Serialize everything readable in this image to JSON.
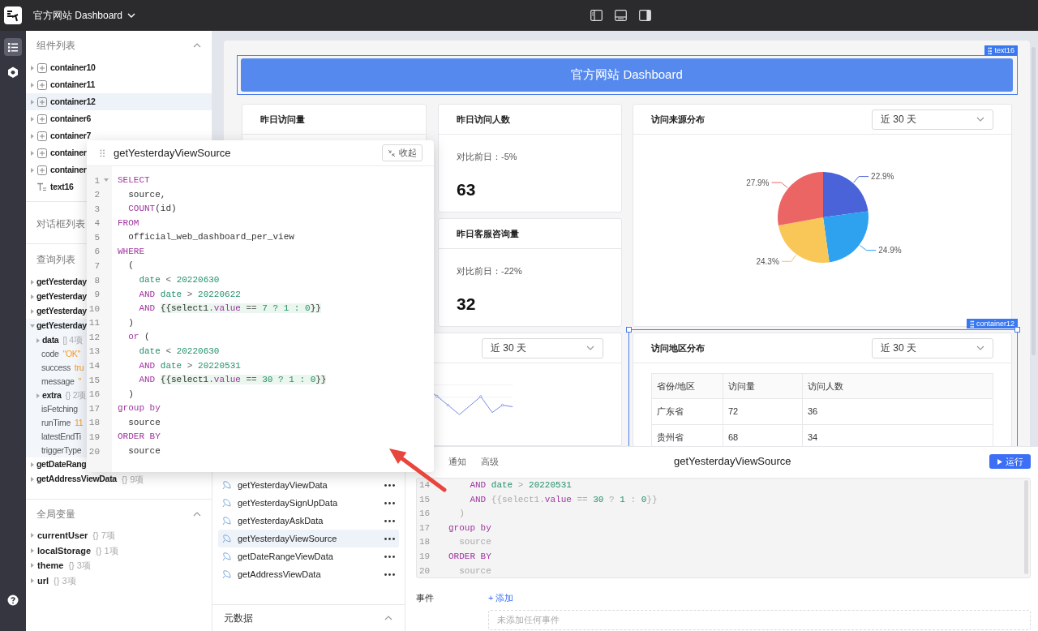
{
  "app": {
    "title": "官方网站 Dashboard"
  },
  "rail": [
    {
      "kind": "tree",
      "selected": true
    },
    {
      "kind": "settings",
      "selected": false
    }
  ],
  "components": {
    "title": "组件列表",
    "expanded": true,
    "items": [
      {
        "label": "container10",
        "kind": "container",
        "expanded": false,
        "selected": false
      },
      {
        "label": "container11",
        "kind": "container",
        "expanded": false,
        "selected": false
      },
      {
        "label": "container12",
        "kind": "container",
        "expanded": false,
        "selected": true
      },
      {
        "label": "container6",
        "kind": "container",
        "expanded": false,
        "selected": false
      },
      {
        "label": "container7",
        "kind": "container",
        "expanded": false,
        "selected": false
      },
      {
        "label": "container",
        "kind": "container",
        "expanded": false,
        "selected": false
      },
      {
        "label": "container",
        "kind": "container",
        "expanded": false,
        "selected": false
      },
      {
        "label": "text16",
        "kind": "text",
        "selected": false
      }
    ]
  },
  "dialogs": {
    "title": "对话框列表"
  },
  "queries": {
    "title": "查询列表",
    "items": [
      {
        "label": "getYesterday",
        "expanded": false
      },
      {
        "label": "getYesterday",
        "expanded": false
      },
      {
        "label": "getYesterday",
        "expanded": false
      },
      {
        "label": "getYesterday",
        "expanded": true,
        "children": [
          {
            "key": "data",
            "kind": "object",
            "value": "[] 4项",
            "expanded": false
          },
          {
            "key": "code",
            "kind": "value",
            "value": "\"OK\""
          },
          {
            "key": "success",
            "kind": "value",
            "value": "tru"
          },
          {
            "key": "message",
            "kind": "value",
            "value": "\""
          },
          {
            "key": "extra",
            "kind": "object",
            "value": "{} 2项",
            "expanded": false
          },
          {
            "key": "isFetching",
            "kind": "value"
          },
          {
            "key": "runTime",
            "kind": "value",
            "value": "11"
          },
          {
            "key": "latestEndTi",
            "kind": "value"
          },
          {
            "key": "triggerType",
            "kind": "value"
          }
        ]
      },
      {
        "label": "getDateRang",
        "expanded": false
      },
      {
        "label": "getAddressViewData",
        "count": "{} 9项",
        "expanded": false
      }
    ]
  },
  "globals": {
    "title": "全局变量",
    "expanded": true,
    "items": [
      {
        "label": "currentUser",
        "count": "{} 7项",
        "expanded": false
      },
      {
        "label": "localStorage",
        "count": "{} 1项",
        "expanded": false
      },
      {
        "label": "theme",
        "count": "{} 3项",
        "expanded": false
      },
      {
        "label": "url",
        "count": "{} 3项",
        "expanded": false
      }
    ]
  },
  "canvas": {
    "banner": {
      "text": "官方网站 Dashboard",
      "tag": "text16"
    },
    "stat_cards": [
      {
        "title": "昨日访问量"
      },
      {
        "title": "昨日访问人数",
        "compare": "对比前日：-5%",
        "value": "63"
      },
      {
        "title": "昨日客服咨询量",
        "compare": "对比前日：-22%",
        "value": "32"
      }
    ],
    "source_card": {
      "title": "访问来源分布",
      "select": "近 30 天",
      "chart_data": {
        "type": "pie",
        "values": [
          22.9,
          24.9,
          24.3,
          27.9
        ],
        "value_labels": [
          "22.9%",
          "24.9%",
          "24.3%",
          "27.9%"
        ]
      }
    },
    "trend_card": {
      "select": "近 30 天"
    },
    "region_card": {
      "title": "访问地区分布",
      "select": "近 30 天",
      "tag": "container12",
      "table": {
        "columns": [
          "省份/地区",
          "访问量",
          "访问人数"
        ],
        "rows": [
          [
            "广东省",
            "72",
            "36"
          ],
          [
            "贵州省",
            "68",
            "34"
          ]
        ]
      }
    }
  },
  "popup": {
    "title": "getYesterdayViewSource",
    "button": "收起",
    "lines": [
      {
        "n": "1",
        "fold": true,
        "tokens": [
          {
            "kind": "keyword",
            "text": "SELECT"
          }
        ]
      },
      {
        "n": "2",
        "fold": false,
        "tokens": [
          {
            "kind": "plain",
            "text": "  source,"
          }
        ]
      },
      {
        "n": "3",
        "fold": false,
        "tokens": [
          {
            "kind": "keyword",
            "text": "  COUNT"
          },
          {
            "kind": "plain",
            "text": "(id)"
          }
        ]
      },
      {
        "n": "4",
        "fold": false,
        "tokens": [
          {
            "kind": "keyword",
            "text": "FROM"
          }
        ]
      },
      {
        "n": "5",
        "fold": false,
        "tokens": [
          {
            "kind": "plain",
            "text": "  official_web_dashboard_per_view"
          }
        ]
      },
      {
        "n": "6",
        "fold": false,
        "tokens": [
          {
            "kind": "keyword",
            "text": "WHERE"
          }
        ]
      },
      {
        "n": "7",
        "fold": false,
        "tokens": [
          {
            "kind": "plain",
            "text": "  ("
          }
        ]
      },
      {
        "n": "8",
        "fold": false,
        "tokens": [
          {
            "kind": "field",
            "text": "    date"
          },
          {
            "kind": "operator",
            "text": " < "
          },
          {
            "kind": "number",
            "text": "20220630"
          }
        ]
      },
      {
        "n": "9",
        "fold": false,
        "tokens": [
          {
            "kind": "keyword",
            "text": "    AND "
          },
          {
            "kind": "field",
            "text": "date"
          },
          {
            "kind": "operator",
            "text": " > "
          },
          {
            "kind": "number",
            "text": "20220622"
          }
        ]
      },
      {
        "n": "10",
        "fold": false,
        "tokens": [
          {
            "kind": "keyword",
            "text": "    AND "
          },
          {
            "kind": "template",
            "parts": [
              {
                "kind": "plain",
                "text": "{{select1"
              },
              {
                "kind": "keyword",
                "text": ".value"
              },
              {
                "kind": "operator",
                "text": " == "
              },
              {
                "kind": "number",
                "text": "7 ? 1 : 0"
              },
              {
                "kind": "plain",
                "text": "}}"
              }
            ]
          }
        ]
      },
      {
        "n": "11",
        "fold": false,
        "tokens": [
          {
            "kind": "plain",
            "text": "  )"
          }
        ]
      },
      {
        "n": "12",
        "fold": false,
        "tokens": [
          {
            "kind": "keyword",
            "text": "  or "
          },
          {
            "kind": "plain",
            "text": "("
          }
        ]
      },
      {
        "n": "13",
        "fold": false,
        "tokens": [
          {
            "kind": "field",
            "text": "    date"
          },
          {
            "kind": "operator",
            "text": " < "
          },
          {
            "kind": "number",
            "text": "20220630"
          }
        ]
      },
      {
        "n": "14",
        "fold": false,
        "tokens": [
          {
            "kind": "keyword",
            "text": "    AND "
          },
          {
            "kind": "field",
            "text": "date"
          },
          {
            "kind": "operator",
            "text": " > "
          },
          {
            "kind": "number",
            "text": "20220531"
          }
        ]
      },
      {
        "n": "15",
        "fold": false,
        "tokens": [
          {
            "kind": "keyword",
            "text": "    AND "
          },
          {
            "kind": "template",
            "parts": [
              {
                "kind": "plain",
                "text": "{{select1"
              },
              {
                "kind": "keyword",
                "text": ".value"
              },
              {
                "kind": "operator",
                "text": " == "
              },
              {
                "kind": "number",
                "text": "30 ? 1 : 0"
              },
              {
                "kind": "plain",
                "text": "}}"
              }
            ]
          }
        ]
      },
      {
        "n": "16",
        "fold": false,
        "tokens": [
          {
            "kind": "plain",
            "text": "  )"
          }
        ]
      },
      {
        "n": "17",
        "fold": false,
        "tokens": [
          {
            "kind": "keyword",
            "text": "group by"
          }
        ]
      },
      {
        "n": "18",
        "fold": false,
        "tokens": [
          {
            "kind": "plain",
            "text": "  source"
          }
        ]
      },
      {
        "n": "19",
        "fold": false,
        "tokens": [
          {
            "kind": "keyword",
            "text": "ORDER BY"
          }
        ]
      },
      {
        "n": "20",
        "fold": false,
        "tokens": [
          {
            "kind": "plain",
            "text": "  source"
          }
        ]
      }
    ]
  },
  "bottom": {
    "queries": [
      {
        "label": "getYesterdayViewData",
        "selected": false
      },
      {
        "label": "getYesterdaySignUpData",
        "selected": false
      },
      {
        "label": "getYesterdayAskData",
        "selected": false
      },
      {
        "label": "getYesterdayViewSource",
        "selected": true
      },
      {
        "label": "getDateRangeViewData",
        "selected": false
      },
      {
        "label": "getAddressViewData",
        "selected": false
      }
    ],
    "section": {
      "title": "元数据",
      "expanded": true
    },
    "tabs": [
      {
        "label": "通知",
        "selected": false
      },
      {
        "label": "高级",
        "selected": false
      }
    ],
    "title": "getYesterdayViewSource",
    "run": "运行",
    "lines": [
      {
        "n": "14",
        "tokens": [
          {
            "kind": "keyword",
            "text": "    AND "
          },
          {
            "kind": "field",
            "text": "date"
          },
          {
            "kind": "operator",
            "text": " > "
          },
          {
            "kind": "number",
            "text": "20220531"
          }
        ]
      },
      {
        "n": "15",
        "tokens": [
          {
            "kind": "keyword",
            "text": "    AND "
          },
          {
            "kind": "operator",
            "text": "{{select1."
          },
          {
            "kind": "keyword",
            "text": "value"
          },
          {
            "kind": "operator",
            "text": " == "
          },
          {
            "kind": "number",
            "text": "30"
          },
          {
            "kind": "operator",
            "text": " ? "
          },
          {
            "kind": "number",
            "text": "1"
          },
          {
            "kind": "operator",
            "text": " : "
          },
          {
            "kind": "number",
            "text": "0"
          },
          {
            "kind": "operator",
            "text": "}}"
          }
        ]
      },
      {
        "n": "16",
        "tokens": [
          {
            "kind": "operator",
            "text": "  )"
          }
        ]
      },
      {
        "n": "17",
        "tokens": [
          {
            "kind": "keyword",
            "text": "group by"
          }
        ]
      },
      {
        "n": "18",
        "tokens": [
          {
            "kind": "operator",
            "text": "  source"
          }
        ]
      },
      {
        "n": "19",
        "tokens": [
          {
            "kind": "keyword",
            "text": "ORDER BY"
          }
        ]
      },
      {
        "n": "20",
        "tokens": [
          {
            "kind": "operator",
            "text": "  source"
          }
        ]
      }
    ],
    "events_label": "事件",
    "add": "+ 添加",
    "events_placeholder": "未添加任何事件"
  }
}
